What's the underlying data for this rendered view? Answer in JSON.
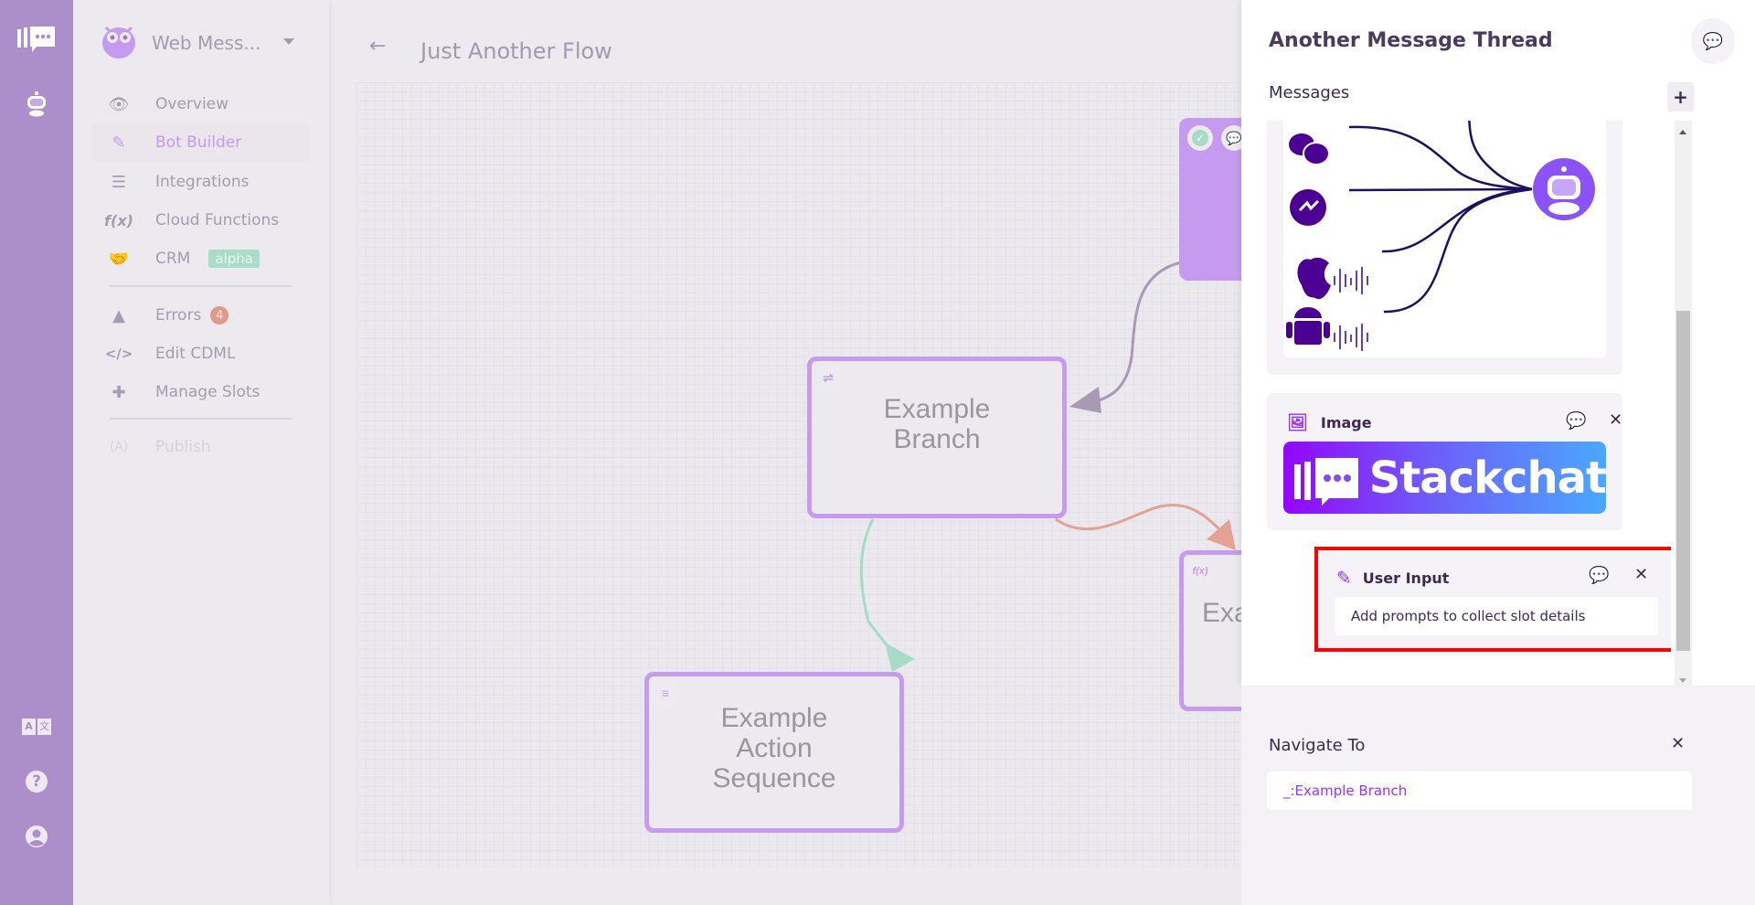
{
  "app": {
    "bot_name": "Web Mess...",
    "flow_title": "Just Another Flow"
  },
  "sidebar": {
    "items": [
      {
        "label": "Overview",
        "icon": "eye-icon"
      },
      {
        "label": "Bot Builder",
        "icon": "pencil-icon",
        "active": true
      },
      {
        "label": "Integrations",
        "icon": "layers-plus-icon"
      },
      {
        "label": "Cloud Functions",
        "icon": "function-icon"
      },
      {
        "label": "CRM",
        "icon": "handshake-icon",
        "badge": "alpha"
      },
      {
        "label": "Errors",
        "icon": "warning-icon",
        "badge": "4"
      },
      {
        "label": "Edit CDML",
        "icon": "code-icon"
      },
      {
        "label": "Manage Slots",
        "icon": "puzzle-icon"
      },
      {
        "label": "Publish",
        "icon": "broadcast-icon",
        "disabled": true
      }
    ]
  },
  "canvas": {
    "nodes": [
      {
        "label": "Example Branch",
        "type": "branch"
      },
      {
        "label": "Example Action Sequence",
        "type": "action-sequence"
      },
      {
        "label": "Exa",
        "type": "cloud-function"
      }
    ],
    "edge_colors": {
      "default": "#a89ab5",
      "success": "#a6dbc8",
      "failure": "#e3a295"
    }
  },
  "panel": {
    "title": "Another Message Thread",
    "messages_label": "Messages",
    "image_card": {
      "label": "Image",
      "banner_text": "Stackchat"
    },
    "user_input_card": {
      "label": "User Input",
      "placeholder": "Add prompts to collect slot details"
    },
    "navigate": {
      "label": "Navigate To",
      "value": "_:Example Branch"
    }
  },
  "colors": {
    "accent": "#9b30ff",
    "rail": "#ac8fca",
    "node_border": "#c69bef",
    "highlight": "#ff0000"
  }
}
